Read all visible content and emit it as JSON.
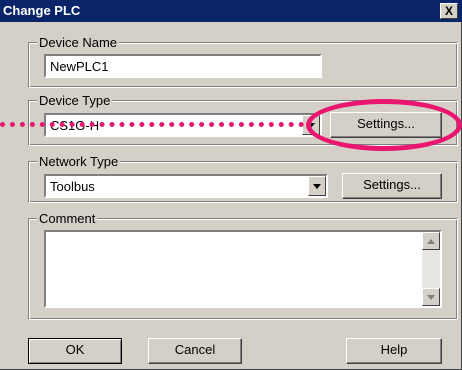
{
  "window": {
    "title": "Change PLC",
    "close_glyph": "X"
  },
  "device_name": {
    "label": "Device Name",
    "value": "NewPLC1"
  },
  "device_type": {
    "label": "Device Type",
    "value": "CS1G-H",
    "settings_label": "Settings..."
  },
  "network_type": {
    "label": "Network Type",
    "value": "Toolbus",
    "settings_label": "Settings..."
  },
  "comment": {
    "label": "Comment",
    "value": ""
  },
  "buttons": {
    "ok": "OK",
    "cancel": "Cancel",
    "help": "Help"
  },
  "annotation": {
    "color": "#e8166f"
  }
}
